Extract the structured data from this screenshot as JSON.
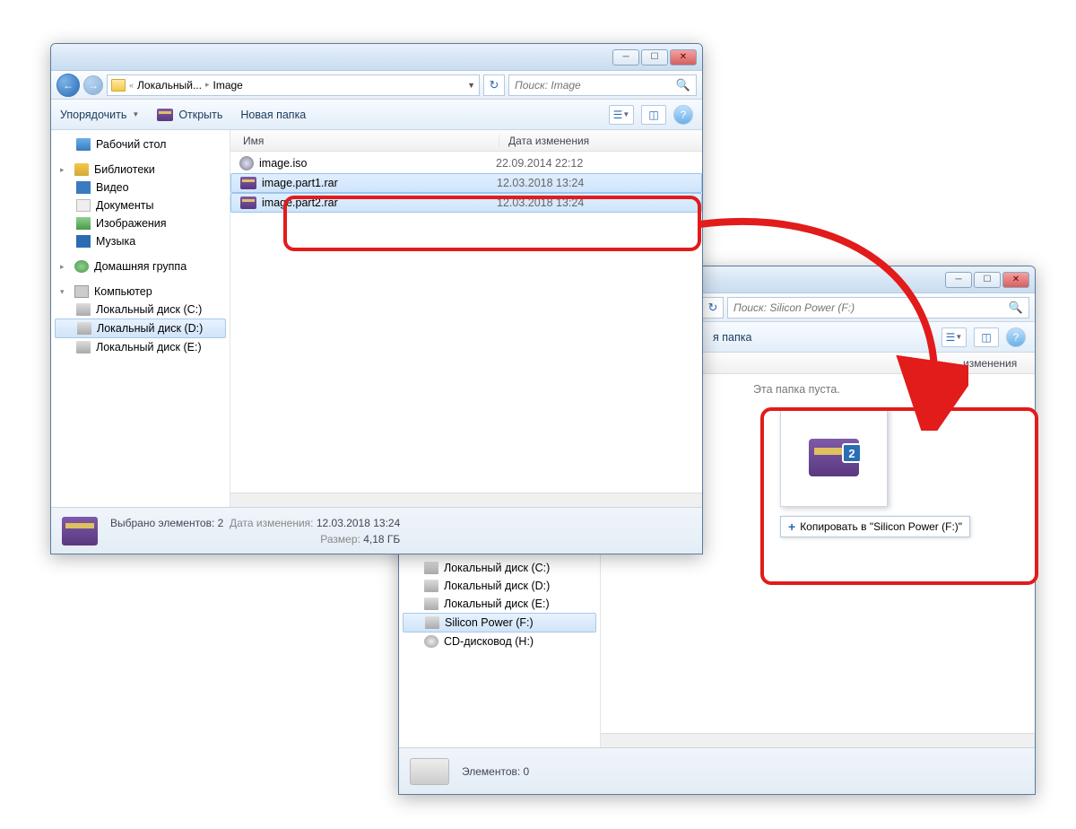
{
  "window1": {
    "breadcrumb": {
      "part1": "Локальный...",
      "part2": "Image"
    },
    "search_placeholder": "Поиск: Image",
    "toolbar": {
      "organize": "Упорядочить",
      "open": "Открыть",
      "new_folder": "Новая папка"
    },
    "sidebar": {
      "desktop": "Рабочий стол",
      "libraries": "Библиотеки",
      "video": "Видео",
      "documents": "Документы",
      "images": "Изображения",
      "music": "Музыка",
      "homegroup": "Домашняя группа",
      "computer": "Компьютер",
      "drive_c": "Локальный диск (C:)",
      "drive_d": "Локальный диск (D:)",
      "drive_e": "Локальный диск (E:)"
    },
    "columns": {
      "name": "Имя",
      "date": "Дата изменения"
    },
    "files": [
      {
        "name": "image.iso",
        "date": "22.09.2014 22:12"
      },
      {
        "name": "image.part1.rar",
        "date": "12.03.2018 13:24"
      },
      {
        "name": "image.part2.rar",
        "date": "12.03.2018 13:24"
      }
    ],
    "status": {
      "selected": "Выбрано элементов: 2",
      "date_label": "Дата изменения:",
      "date_value": "12.03.2018 13:24",
      "size_label": "Размер:",
      "size_value": "4,18 ГБ"
    }
  },
  "window2": {
    "search_placeholder": "Поиск: Silicon Power (F:)",
    "toolbar": {
      "new_folder_tail": "я папка"
    },
    "columns": {
      "date_tail": "изменения"
    },
    "sidebar": {
      "drive_c": "Локальный диск (C:)",
      "drive_d": "Локальный диск (D:)",
      "drive_e": "Локальный диск (E:)",
      "drive_f": "Silicon Power (F:)",
      "cd_drive": "CD-дисковод (H:)"
    },
    "empty_msg": "Эта папка пуста.",
    "drag_tooltip": "Копировать в \"Silicon Power (F:)\"",
    "drag_count": "2",
    "status": {
      "elements": "Элементов: 0"
    }
  }
}
